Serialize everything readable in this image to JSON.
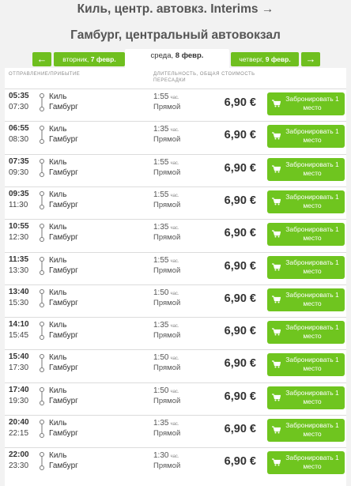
{
  "header": {
    "title_line1": "Киль, центр. автовкз. Interims →",
    "title_line2": "Гамбург, центральный автовокзал"
  },
  "days": {
    "prev_arrow": "←",
    "next_arrow": "→",
    "prev_weekday": "вторник,",
    "prev_date": "7 февр.",
    "current_weekday": "среда,",
    "current_date": "8 февр.",
    "next_weekday": "четверг,",
    "next_date": "9 февр."
  },
  "columns": {
    "departure_arrival": "ОТПРАВЛЕНИЕ/ПРИБЫТИЕ",
    "duration_price": "ДЛИТЕЛЬНОСТЬ, ОБЩАЯ СТОИМОСТЬ ПЕРЕСАДКИ"
  },
  "trips": [
    {
      "dep": "05:35",
      "arr": "07:30",
      "from": "Киль",
      "to": "Гамбург",
      "dur": "1:55",
      "unit": "час.",
      "kind": "Прямой",
      "price": "6,90 €",
      "book": "Забронировать 1 место"
    },
    {
      "dep": "06:55",
      "arr": "08:30",
      "from": "Киль",
      "to": "Гамбург",
      "dur": "1:35",
      "unit": "час.",
      "kind": "Прямой",
      "price": "6,90 €",
      "book": "Забронировать 1 место"
    },
    {
      "dep": "07:35",
      "arr": "09:30",
      "from": "Киль",
      "to": "Гамбург",
      "dur": "1:55",
      "unit": "час.",
      "kind": "Прямой",
      "price": "6,90 €",
      "book": "Забронировать 1 место"
    },
    {
      "dep": "09:35",
      "arr": "11:30",
      "from": "Киль",
      "to": "Гамбург",
      "dur": "1:55",
      "unit": "час.",
      "kind": "Прямой",
      "price": "6,90 €",
      "book": "Забронировать 1 место"
    },
    {
      "dep": "10:55",
      "arr": "12:30",
      "from": "Киль",
      "to": "Гамбург",
      "dur": "1:35",
      "unit": "час.",
      "kind": "Прямой",
      "price": "6,90 €",
      "book": "Забронировать 1 место"
    },
    {
      "dep": "11:35",
      "arr": "13:30",
      "from": "Киль",
      "to": "Гамбург",
      "dur": "1:55",
      "unit": "час.",
      "kind": "Прямой",
      "price": "6,90 €",
      "book": "Забронировать 1 место"
    },
    {
      "dep": "13:40",
      "arr": "15:30",
      "from": "Киль",
      "to": "Гамбург",
      "dur": "1:50",
      "unit": "час.",
      "kind": "Прямой",
      "price": "6,90 €",
      "book": "Забронировать 1 место"
    },
    {
      "dep": "14:10",
      "arr": "15:45",
      "from": "Киль",
      "to": "Гамбург",
      "dur": "1:35",
      "unit": "час.",
      "kind": "Прямой",
      "price": "6,90 €",
      "book": "Забронировать 1 место"
    },
    {
      "dep": "15:40",
      "arr": "17:30",
      "from": "Киль",
      "to": "Гамбург",
      "dur": "1:50",
      "unit": "час.",
      "kind": "Прямой",
      "price": "6,90 €",
      "book": "Забронировать 1 место"
    },
    {
      "dep": "17:40",
      "arr": "19:30",
      "from": "Киль",
      "to": "Гамбург",
      "dur": "1:50",
      "unit": "час.",
      "kind": "Прямой",
      "price": "6,90 €",
      "book": "Забронировать 1 место"
    },
    {
      "dep": "20:40",
      "arr": "22:15",
      "from": "Киль",
      "to": "Гамбург",
      "dur": "1:35",
      "unit": "час.",
      "kind": "Прямой",
      "price": "6,90 €",
      "book": "Забронировать 1 место"
    },
    {
      "dep": "22:00",
      "arr": "23:30",
      "from": "Киль",
      "to": "Гамбург",
      "dur": "1:30",
      "unit": "час.",
      "kind": "Прямой",
      "price": "6,90 €",
      "book": "Забронировать 1 место"
    }
  ],
  "icons": {
    "route": "route-dots-icon",
    "cart": "cart-icon"
  },
  "colors": {
    "accent_green": "#6fc51f",
    "tab_green": "#6fbf1f"
  }
}
